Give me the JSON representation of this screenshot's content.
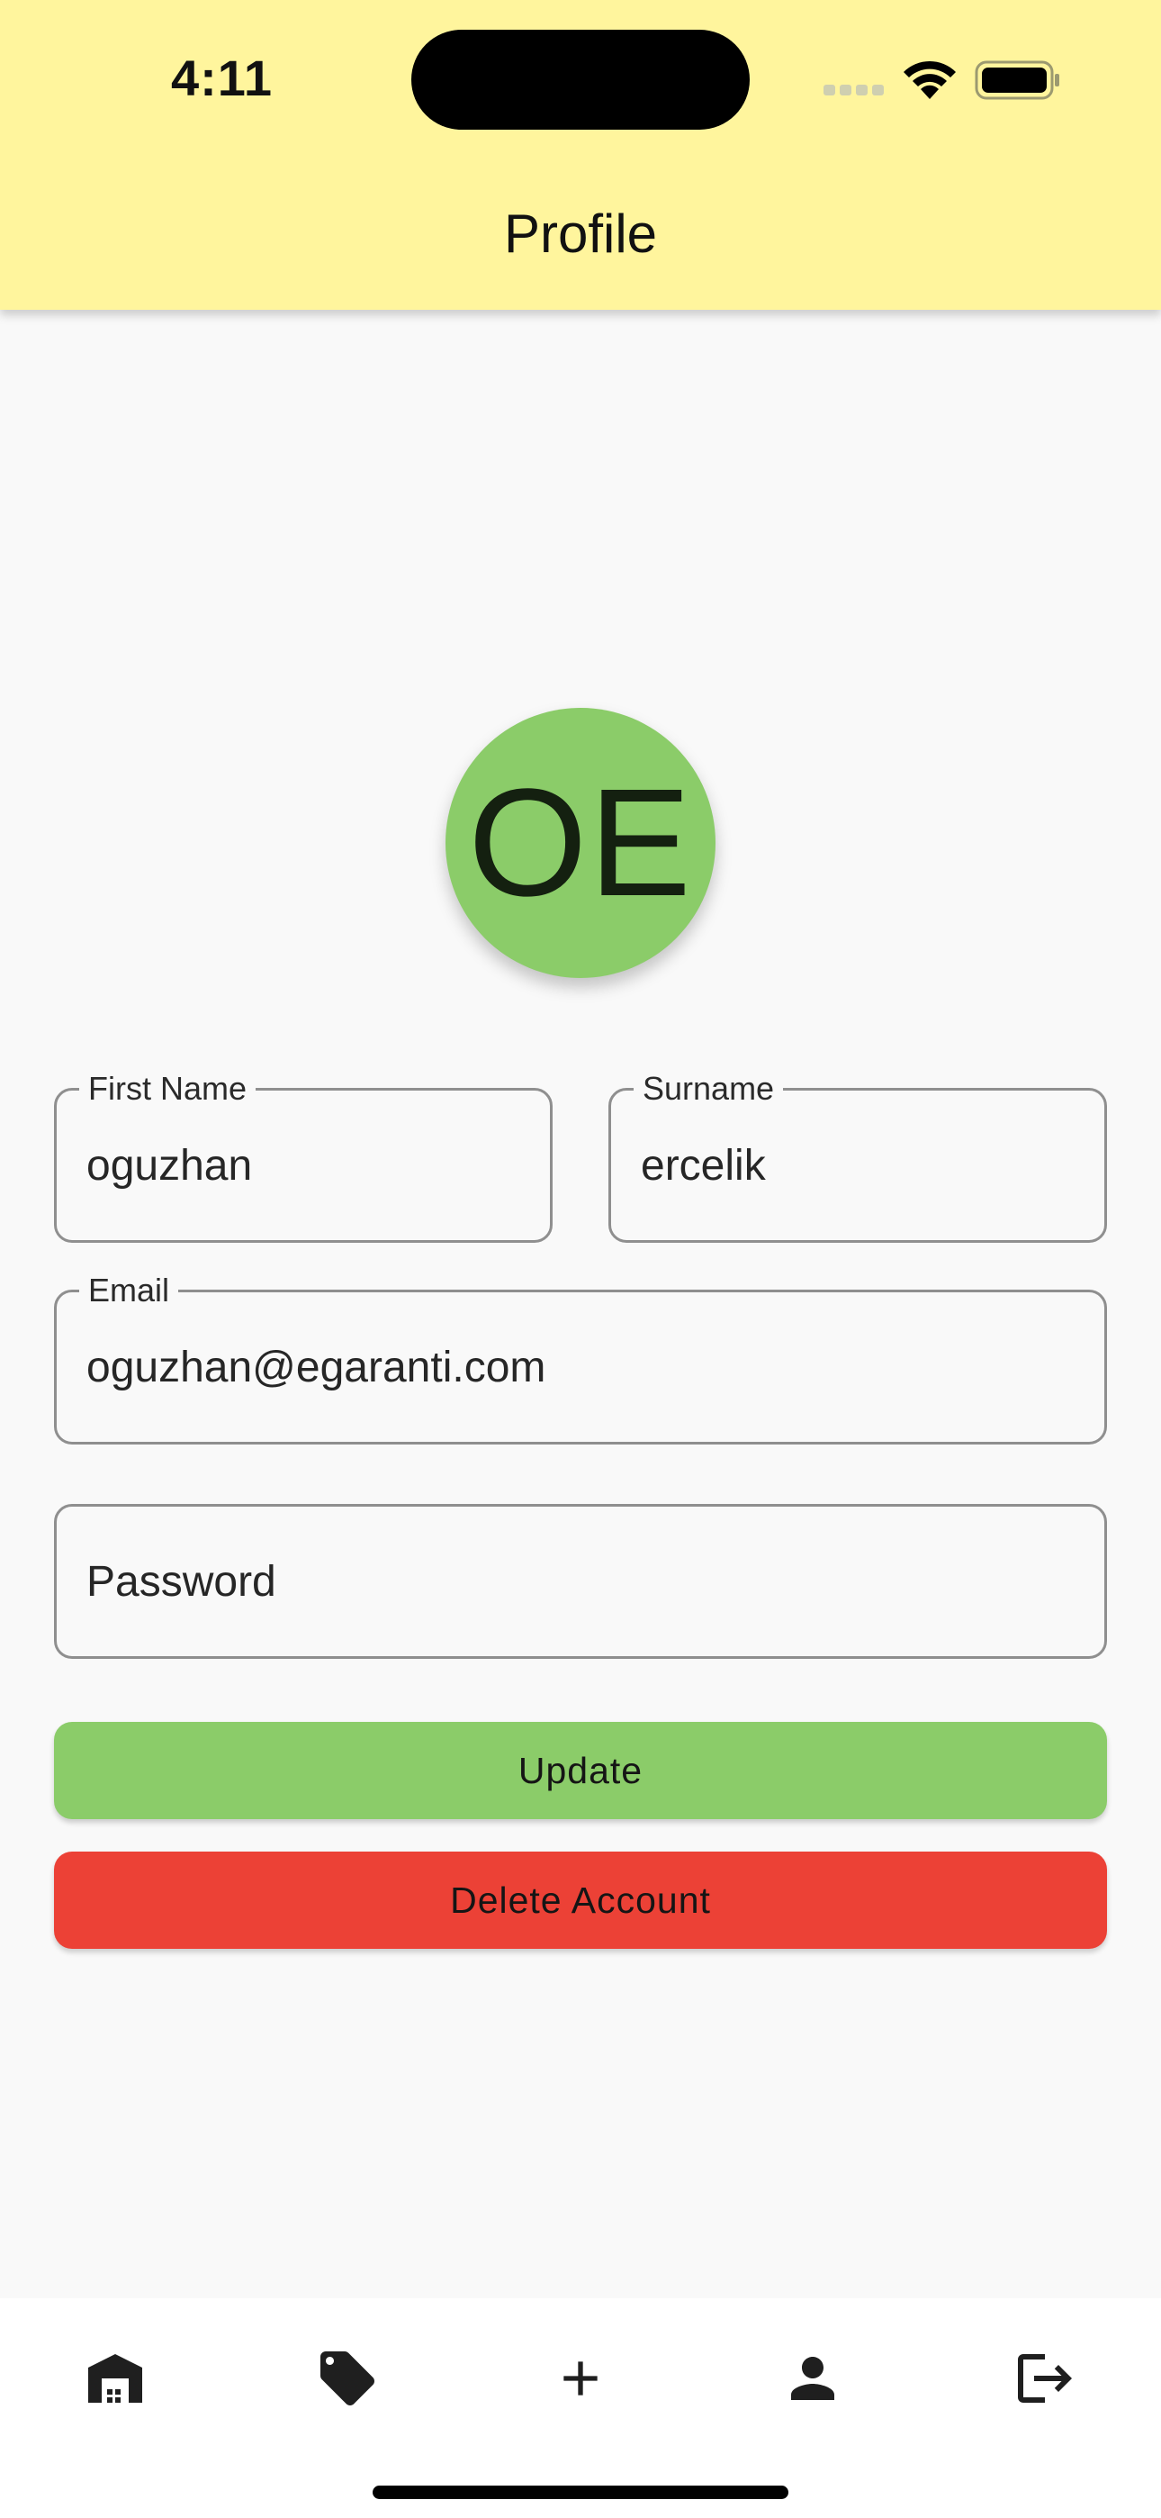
{
  "status_bar": {
    "time": "4:11"
  },
  "appbar": {
    "title": "Profile",
    "background": "#fff59d"
  },
  "avatar": {
    "initials": "OE",
    "color": "#8bcc69"
  },
  "form": {
    "first_name": {
      "label": "First Name",
      "value": "oguzhan"
    },
    "surname": {
      "label": "Surname",
      "value": "ercelik"
    },
    "email": {
      "label": "Email",
      "value": "oguzhan@egaranti.com"
    },
    "password": {
      "placeholder": "Password"
    }
  },
  "buttons": {
    "update": {
      "label": "Update",
      "color": "#8bcc69"
    },
    "delete": {
      "label": "Delete Account",
      "color": "#ec4136"
    }
  },
  "bottom_nav": {
    "items": [
      {
        "icon": "warehouse-icon"
      },
      {
        "icon": "tag-icon"
      },
      {
        "icon": "add-icon"
      },
      {
        "icon": "person-icon"
      },
      {
        "icon": "logout-icon"
      }
    ]
  }
}
